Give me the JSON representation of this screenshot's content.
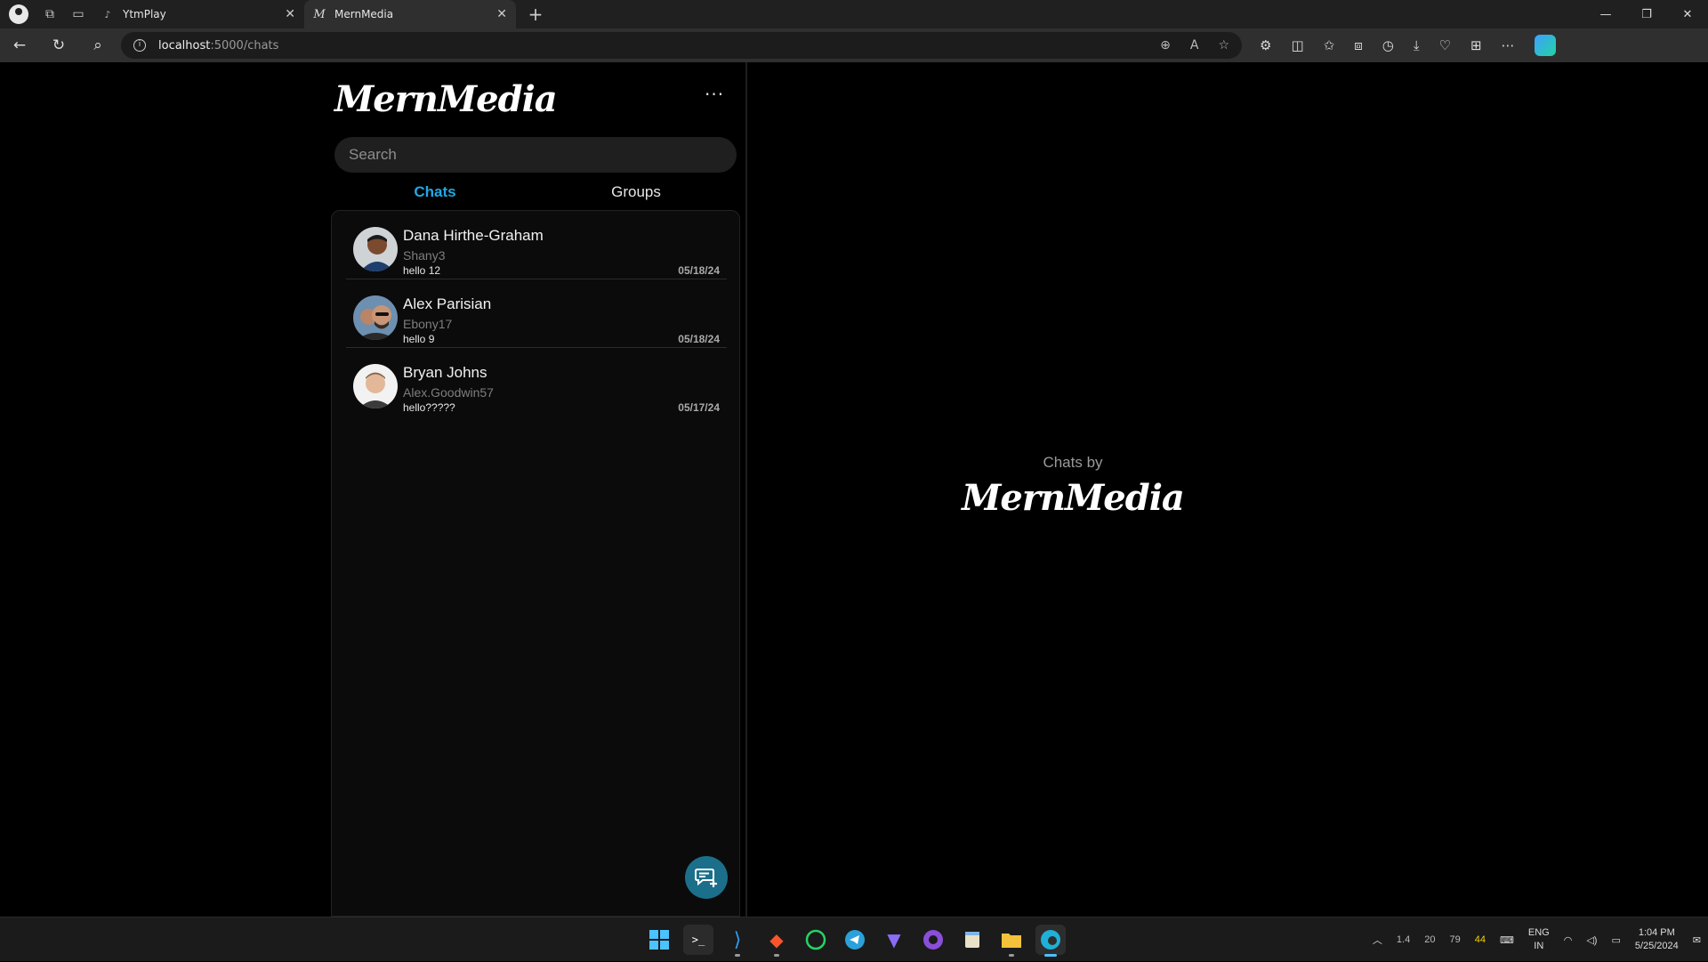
{
  "browser": {
    "tabs": [
      {
        "title": "YtmPlay",
        "active": false
      },
      {
        "title": "MernMedia",
        "active": true
      }
    ],
    "url_host": "localhost",
    "url_path": ":5000/chats"
  },
  "app": {
    "logo": "MernMedia",
    "more_label": "···",
    "search_placeholder": "Search",
    "tabs": {
      "chats": "Chats",
      "groups": "Groups"
    },
    "chats": [
      {
        "name": "Dana Hirthe-Graham",
        "username": "Shany3",
        "last_message": "hello 12",
        "date": "05/18/24"
      },
      {
        "name": "Alex Parisian",
        "username": "Ebony17",
        "last_message": "hello 9",
        "date": "05/18/24"
      },
      {
        "name": "Bryan Johns",
        "username": "Alex.Goodwin57",
        "last_message": "hello?????",
        "date": "05/17/24"
      }
    ],
    "empty_state": {
      "caption": "Chats by",
      "logo": "MernMedia"
    }
  },
  "taskbar": {
    "tray_values": [
      "1.4",
      "20",
      "79",
      "44"
    ],
    "lang_top": "ENG",
    "lang_bottom": "IN",
    "time": "1:04 PM",
    "date": "5/25/2024"
  },
  "colors": {
    "accent": "#1fa9e6",
    "fab": "#1c6f8a"
  }
}
